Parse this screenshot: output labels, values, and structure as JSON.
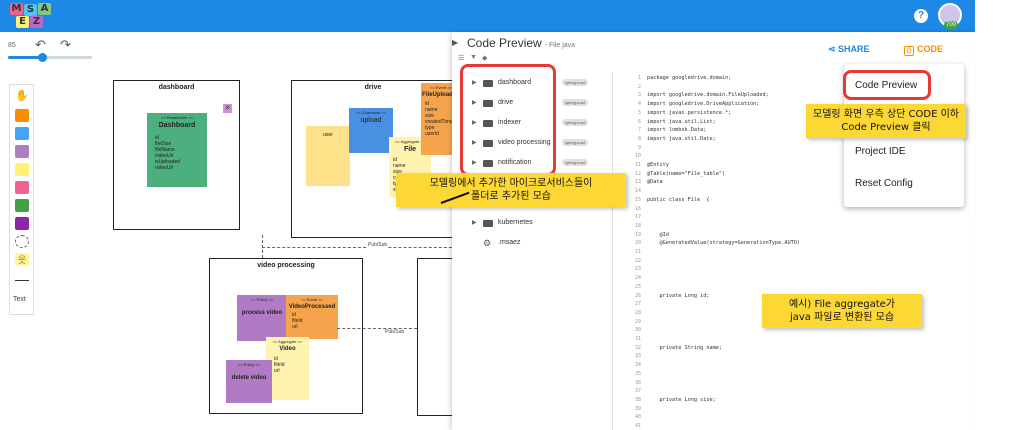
{
  "app": {
    "logo_letters": [
      "M",
      "S",
      "A",
      "E",
      "Z"
    ],
    "logo_colors": [
      "#f06292",
      "#4fc3f7",
      "#81c784",
      "#fff176",
      "#ba68c8"
    ],
    "avatar_badge": "700",
    "help_glyph": "?"
  },
  "toolbar": {
    "zoom": "85"
  },
  "palette": {
    "text_label": "Text"
  },
  "canvas": {
    "contexts": {
      "dashboard": "dashboard",
      "drive": "drive",
      "video": "video processing"
    },
    "stickies": {
      "dashboard_readmodel": {
        "stereo": "<< ReadModel >>",
        "name": "Dashboard",
        "fields": [
          "id",
          "fileSize",
          "fileName",
          "videoUrl",
          "isUploaded",
          "videoUrl"
        ]
      },
      "user": {
        "name": "user"
      },
      "upload": {
        "stereo": "<< Command >>",
        "name": "upload"
      },
      "file": {
        "stereo": "<< Aggregate >>",
        "name": "File",
        "fields": [
          "id",
          "name",
          "size",
          "createdTime",
          "type",
          "size"
        ]
      },
      "file_uploaded": {
        "stereo": "<< Event >>",
        "name": "FileUploaded",
        "fields": [
          "id",
          "name",
          "size",
          "createdTime",
          "type",
          "userId"
        ]
      },
      "policy_process": {
        "stereo": "<< Policy >>",
        "name": "process video"
      },
      "video_processed": {
        "stereo": "<< Event >>",
        "name": "VideoProcessed",
        "fields": [
          "id",
          "fileId",
          "url"
        ]
      },
      "video_agg": {
        "stereo": "<< Aggregate >>",
        "name": "Video",
        "fields": [
          "id",
          "fileId",
          "url"
        ]
      },
      "policy_delete": {
        "stereo": "<< Policy >>",
        "name": "delete video"
      }
    },
    "pubsub_1": "Pub/Sub",
    "pubsub_2": "Pub/Sub"
  },
  "code_preview": {
    "title": "Code Preview",
    "filename": "- File.java",
    "tree": [
      {
        "label": "dashboard",
        "badge": "spring-boot"
      },
      {
        "label": "drive",
        "badge": "spring-boot"
      },
      {
        "label": "indexer",
        "badge": "spring-boot"
      },
      {
        "label": "video processing",
        "badge": "spring-boot"
      },
      {
        "label": "notification",
        "badge": "spring-boot"
      },
      {
        "label": "gateway",
        "badge": ""
      },
      {
        "label": "kafka",
        "badge": ""
      },
      {
        "label": "kubernetes",
        "badge": ""
      },
      {
        "label": ".msaez",
        "badge": ""
      }
    ],
    "code": [
      "package googledrive.domain;",
      "",
      "import googledrive.domain.FileUploaded;",
      "import googledrive.DriveApplication;",
      "import javax.persistence.*;",
      "import java.util.List;",
      "import lombok.Data;",
      "import java.util.Date;",
      "",
      "",
      "@Entity",
      "@Table(name=\"File_table\")",
      "@Data",
      "",
      "public class File  {",
      "",
      "",
      "",
      "    @Id",
      "    @GeneratedValue(strategy=GenerationType.AUTO)",
      "",
      "",
      "",
      "",
      "",
      "    private Long id;",
      "",
      "",
      "",
      "",
      "",
      "    private String name;",
      "",
      "",
      "",
      "",
      "",
      "    private Long size;",
      "",
      "",
      ""
    ]
  },
  "header_actions": {
    "share": "SHARE",
    "code": "CODE"
  },
  "menu": {
    "items": [
      "Code Preview",
      "Project IDE",
      "Reset Config"
    ]
  },
  "annotations": {
    "callout_menu_line1": "모델링 화면 우측 상단 CODE 이하",
    "callout_menu_line2": "Code Preview 클릭",
    "callout_folders_line1": "모델링에서 추가한 마이크로서비스들이",
    "callout_folders_line2": "폴더로 추가된 모습",
    "callout_java_line1": "예시) File aggregate가",
    "callout_java_line2": "java 파일로 변환된 모습"
  }
}
